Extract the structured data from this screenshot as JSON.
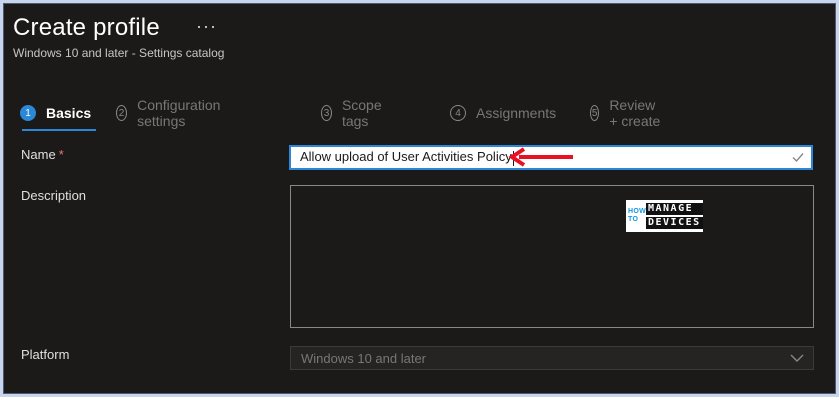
{
  "header": {
    "title": "Create profile",
    "more_label": "···",
    "subtitle": "Windows 10 and later - Settings catalog"
  },
  "steps": [
    {
      "number": "1",
      "label": "Basics",
      "active": true
    },
    {
      "number": "2",
      "label": "Configuration settings",
      "active": false
    },
    {
      "number": "3",
      "label": "Scope tags",
      "active": false
    },
    {
      "number": "4",
      "label": "Assignments",
      "active": false
    },
    {
      "number": "5",
      "label": "Review + create",
      "active": false
    }
  ],
  "form": {
    "name_label": "Name",
    "required_marker": "*",
    "name_value": "Allow upload of User Activities Policy",
    "description_label": "Description",
    "description_value": "",
    "platform_label": "Platform",
    "platform_value": "Windows 10 and later"
  },
  "watermark": {
    "how": "HOW",
    "to": "TO",
    "line1": "MANAGE",
    "line2": "DEVICES"
  },
  "colors": {
    "accent": "#2b88d8",
    "background": "#1b1a19",
    "annotation_arrow": "#e81123",
    "required": "#f1707b"
  }
}
